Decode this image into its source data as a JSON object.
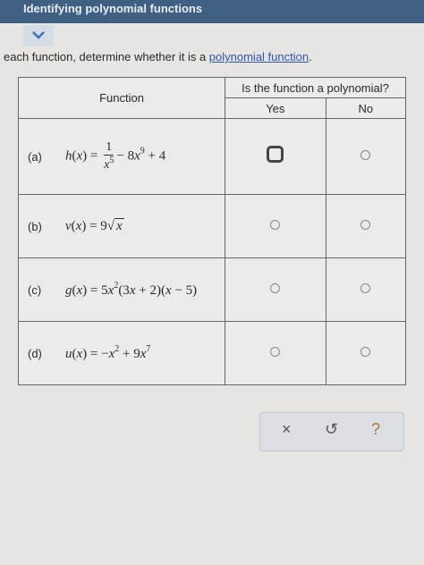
{
  "header": {
    "title": "Identifying polynomial functions"
  },
  "instruction": {
    "text": "each function, determine whether it is a ",
    "link": "polynomial function",
    "end": "."
  },
  "table": {
    "function_header": "Function",
    "question_header": "Is the function a polynomial?",
    "yes_label": "Yes",
    "no_label": "No",
    "rows": [
      {
        "label": "(a)",
        "selected": "yes"
      },
      {
        "label": "(b)",
        "selected": ""
      },
      {
        "label": "(c)",
        "selected": ""
      },
      {
        "label": "(d)",
        "selected": ""
      }
    ]
  },
  "toolbar": {
    "close": "×",
    "undo": "↺",
    "help": "?"
  },
  "colors": {
    "header_bg": "#3f5f83",
    "link": "#2f56a8",
    "help": "#b07a2a"
  }
}
